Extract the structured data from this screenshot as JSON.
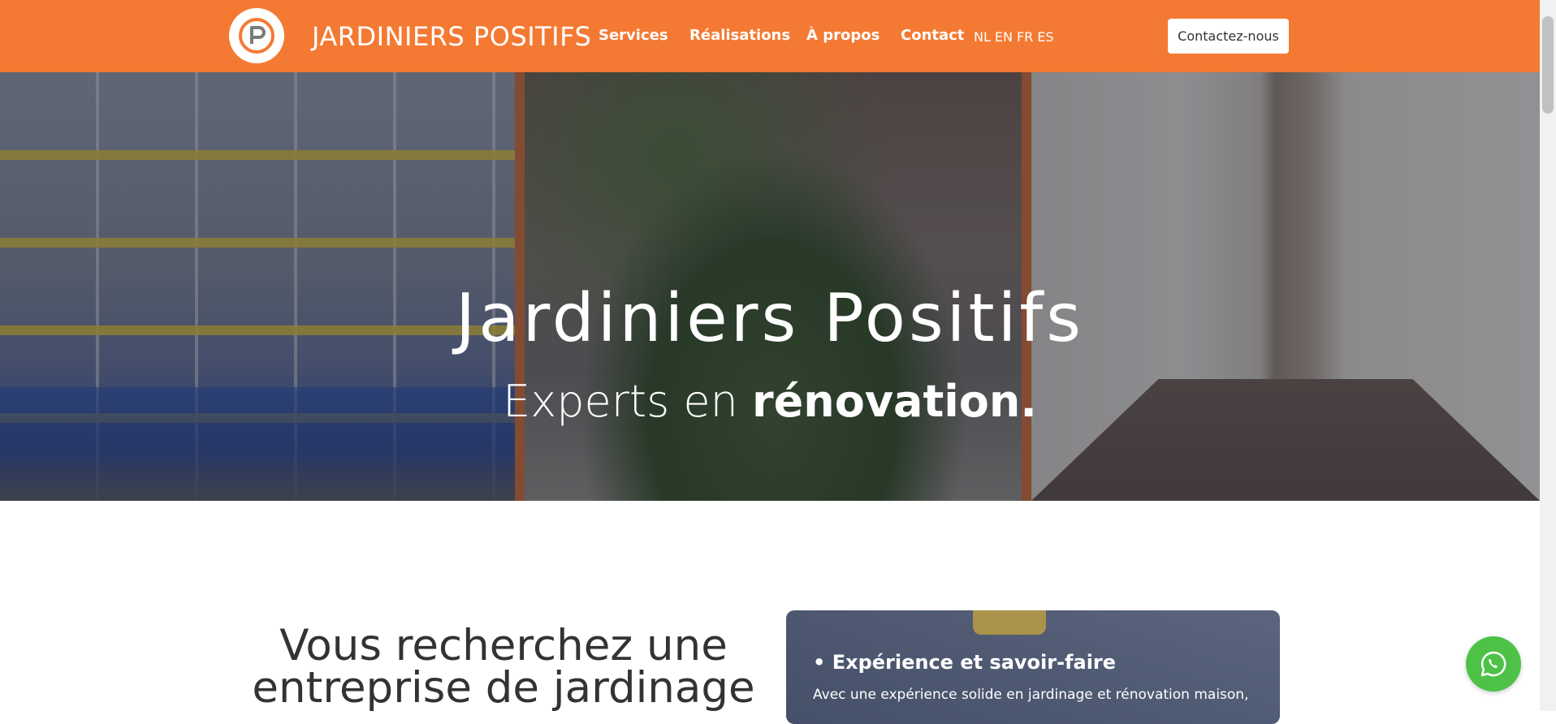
{
  "header": {
    "brand": "JARDINIERS POSITIFS",
    "nav": [
      "Services",
      "Réalisations",
      "À propos",
      "Contact"
    ],
    "languages": [
      "NL",
      "EN",
      "FR",
      "ES"
    ],
    "cta": "Contactez-nous",
    "background_color": "#f47a33"
  },
  "hero": {
    "title": "Jardiniers Positifs",
    "subtitle_light": "Experts en",
    "subtitle_bold": "rénovation."
  },
  "section": {
    "title": "Vous recherchez une entreprise de jardinage"
  },
  "card": {
    "title": "• Expérience et savoir-faire",
    "text": "Avec une expérience solide en jardinage et rénovation maison,"
  },
  "icons": {
    "logo": "logo-p-icon",
    "whatsapp": "whatsapp-icon"
  },
  "colors": {
    "accent": "#f47a33",
    "whatsapp": "#4dc247"
  }
}
